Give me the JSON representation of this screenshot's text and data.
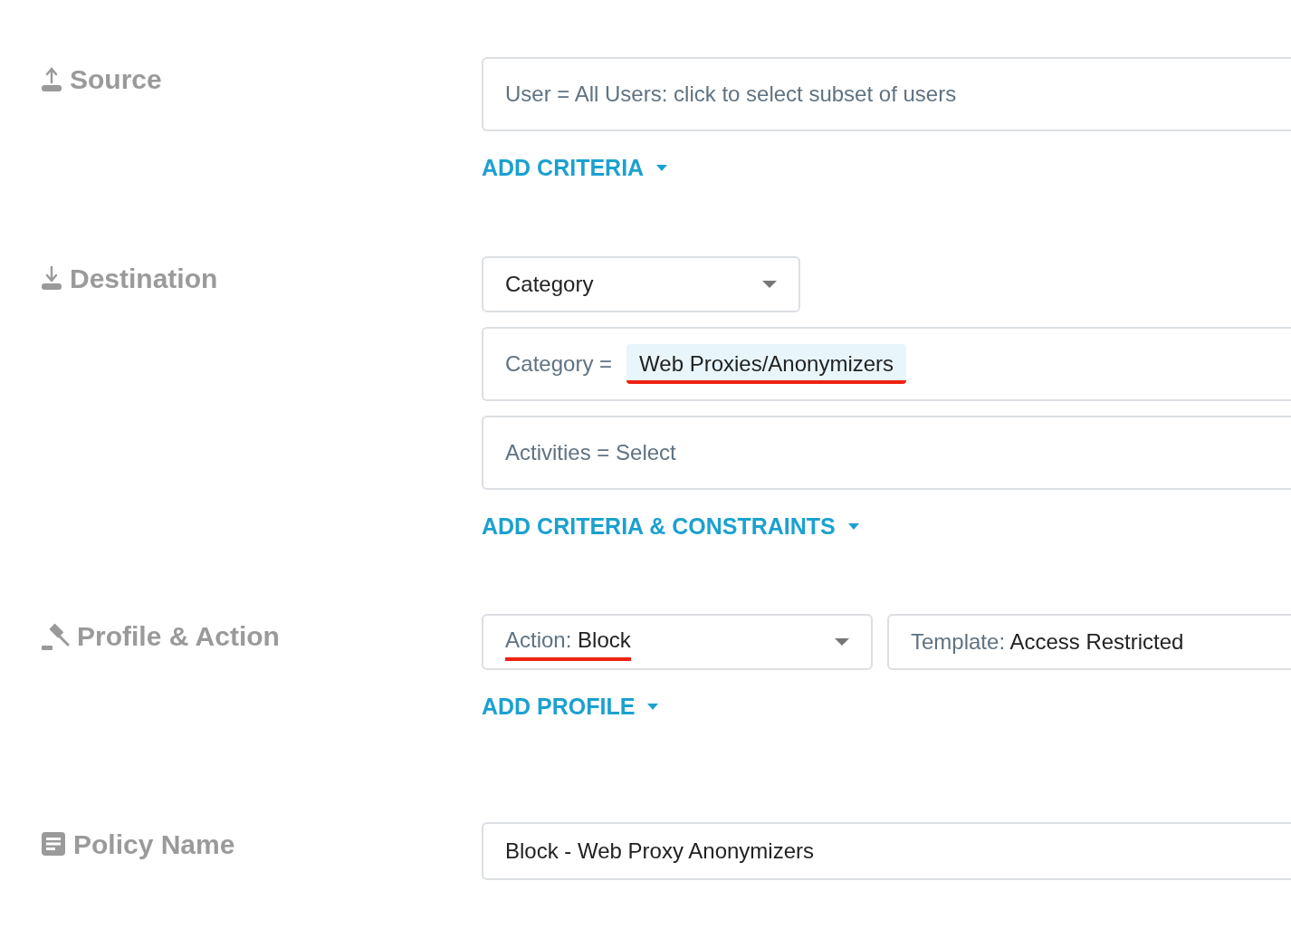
{
  "sections": [
    {
      "kind": "source",
      "title": "Source",
      "rows": [
        {
          "kind": "text_field",
          "text": "User = All Users: click to select subset of users"
        }
      ],
      "add_link": "ADD CRITERIA"
    },
    {
      "kind": "destination",
      "title": "Destination",
      "rows": [
        {
          "kind": "select",
          "value": "Category"
        },
        {
          "kind": "tag_field",
          "label": "Category =",
          "tag": "Web Proxies/Anonymizers",
          "underlined": true
        },
        {
          "kind": "text_field",
          "text": "Activities = Select"
        }
      ],
      "add_link": "ADD CRITERIA & CONSTRAINTS"
    },
    {
      "kind": "action",
      "title": "Profile & Action",
      "rows": [
        {
          "kind": "select_pair",
          "selects": [
            {
              "label": "Action:",
              "value": "Block",
              "underlined": true,
              "caret": true
            },
            {
              "label": "Template:",
              "value": "Access Restricted",
              "underlined": false,
              "caret": false
            }
          ]
        }
      ],
      "add_link": "ADD PROFILE"
    },
    {
      "kind": "name",
      "title": "Policy Name",
      "rows": [
        {
          "kind": "input",
          "value": "Block - Web Proxy Anonymizers"
        }
      ]
    }
  ]
}
